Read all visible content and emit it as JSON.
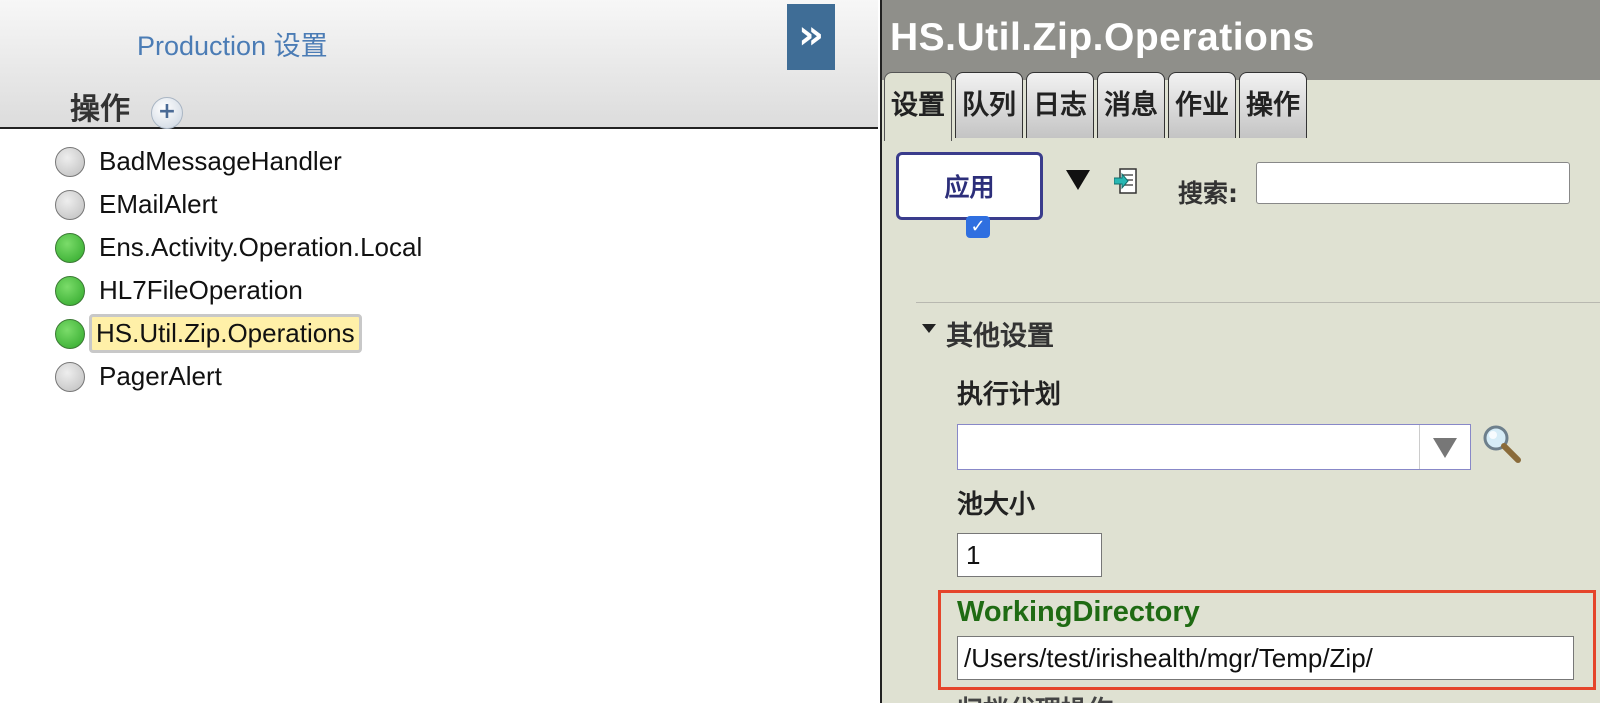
{
  "left_panel": {
    "production_title": "Production 设置",
    "section_label": "操作",
    "expand_glyph": "»",
    "operations": [
      {
        "label": "BadMessageHandler",
        "status": "gray",
        "selected": false
      },
      {
        "label": "EMailAlert",
        "status": "gray",
        "selected": false
      },
      {
        "label": "Ens.Activity.Operation.Local",
        "status": "green",
        "selected": false
      },
      {
        "label": "HL7FileOperation",
        "status": "green",
        "selected": false
      },
      {
        "label": "HS.Util.Zip.Operations",
        "status": "green",
        "selected": true
      },
      {
        "label": "PagerAlert",
        "status": "gray",
        "selected": false
      }
    ]
  },
  "right_panel": {
    "title": "HS.Util.Zip.Operations",
    "tabs": [
      {
        "label": "设置",
        "active": true
      },
      {
        "label": "队列",
        "active": false
      },
      {
        "label": "日志",
        "active": false
      },
      {
        "label": "消息",
        "active": false
      },
      {
        "label": "作业",
        "active": false
      },
      {
        "label": "操作",
        "active": false
      }
    ],
    "apply_label": "应用",
    "search_label": "搜索:",
    "search_value": "",
    "group_label": "其他设置",
    "schedule_label": "执行计划",
    "schedule_value": "",
    "pool_label": "池大小",
    "pool_value": "1",
    "working_dir_label": "WorkingDirectory",
    "working_dir_value": "/Users/test/irishealth/mgr/Temp/Zip/",
    "next_label_partial": "归档代理操作"
  },
  "colors": {
    "accent_blue": "#3f6d96",
    "status_green": "#2fa72a",
    "highlight_red": "#e5452b",
    "label_green": "#1f6b13",
    "panel_bg": "#dfe1d2"
  },
  "icons": {
    "add": "plus-circle-icon",
    "expand": "double-chevron-right-icon",
    "menu": "triangle-down-icon",
    "export": "document-arrow-icon",
    "lookup": "magnifier-icon"
  }
}
